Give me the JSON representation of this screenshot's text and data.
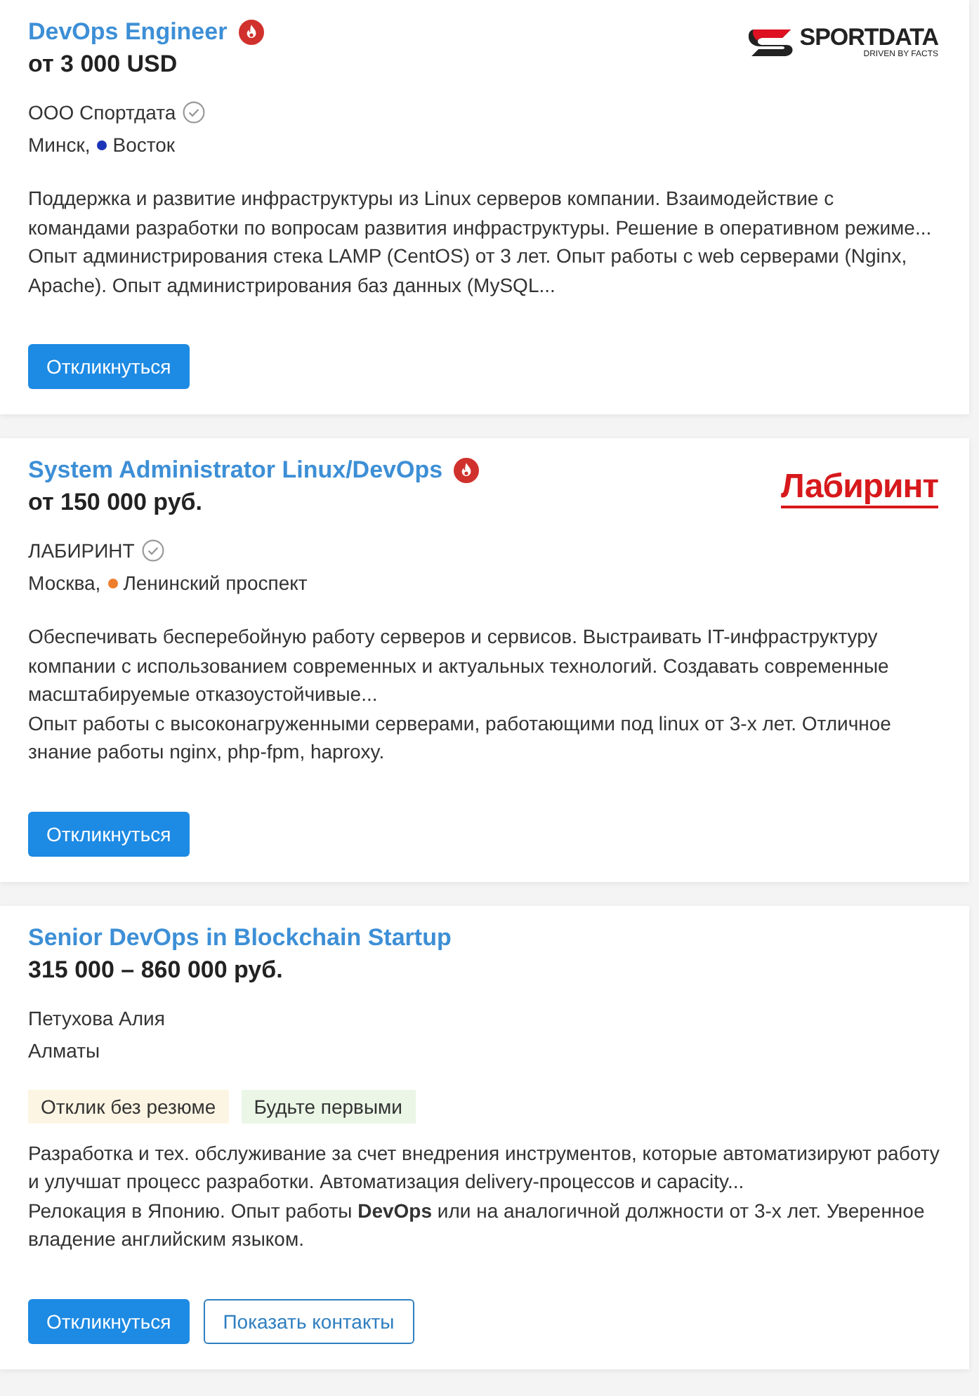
{
  "vacancies": [
    {
      "title": "DevOps Engineer",
      "hot": true,
      "salary": "от 3 000 USD",
      "logo": {
        "kind": "sportdata",
        "text": "SPORTDATA",
        "tagline": "DRIVEN BY FACTS"
      },
      "company": "ООО Спортдата",
      "verified": true,
      "city": "Минск,",
      "metro": {
        "name": "Восток",
        "color": "#1c34b8"
      },
      "description": [
        "Поддержка и развитие инфраструктуры из Linux серверов компании. Взаимодействие с командами разработки по вопросам развития инфраструктуры. Решение в оперативном режиме...",
        "Опыт администрирования стека LAMP (CentOS) от 3 лет. Опыт работы с web серверами (Nginx, Apache). Опыт администрирования баз данных (MySQL..."
      ],
      "buttons": [
        {
          "kind": "primary",
          "label": "Откликнуться"
        }
      ]
    },
    {
      "title": "System Administrator Linux/DevOps",
      "hot": true,
      "salary": "от 150 000 руб.",
      "logo": {
        "kind": "labirint",
        "text": "Лабиринт"
      },
      "company": "ЛАБИРИНТ",
      "verified": true,
      "city": "Москва,",
      "metro": {
        "name": "Ленинский проспект",
        "color": "#ee7d2c"
      },
      "description": [
        "Обеспечивать бесперебойную работу серверов и сервисов. Выстраивать IT-инфраструктуру компании с использованием современных и актуальных технологий. Создавать современные масштабируемые отказоустойчивые...",
        "Опыт работы с высоконагруженными серверами, работающими под linux от 3-х лет. Отличное знание работы nginx, php-fpm, haproxy."
      ],
      "buttons": [
        {
          "kind": "primary",
          "label": "Откликнуться"
        }
      ]
    },
    {
      "title": "Senior DevOps in Blockchain Startup",
      "hot": false,
      "salary": "315 000 – 860 000 руб.",
      "company": "Петухова Алия",
      "verified": false,
      "city": "Алматы",
      "tags": [
        {
          "kind": "warning",
          "text": "Отклик без резюме"
        },
        {
          "kind": "success",
          "text": "Будьте первыми"
        }
      ],
      "description": [
        "Разработка и тех. обслуживание за счет внедрения инструментов, которые автоматизируют работу и улучшат процесс разработки. Автоматизация delivery-процессов и capacity...",
        "Релокация в Японию. Опыт работы **DevOps** или на аналогичной должности от 3-х лет. Уверенное владение английским языком."
      ],
      "buttons": [
        {
          "kind": "primary",
          "label": "Откликнуться"
        },
        {
          "kind": "outline",
          "label": "Показать контакты"
        }
      ]
    }
  ]
}
